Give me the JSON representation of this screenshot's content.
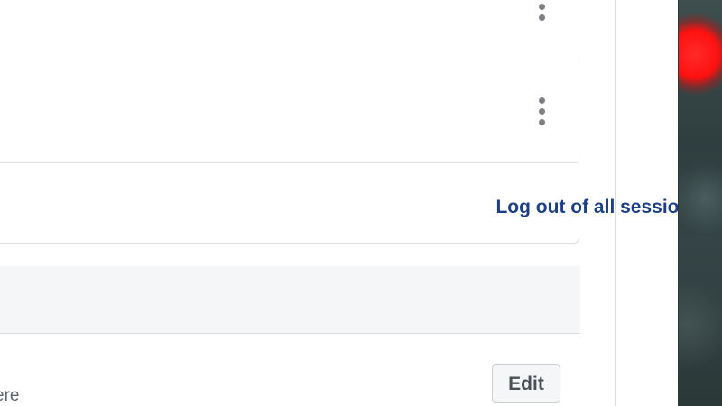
{
  "sessions": {
    "more_icon": "vertical-ellipsis",
    "logout_all_label": "Log out of all sessions"
  },
  "next_section": {
    "setting_partial_text": "ere",
    "edit_label": "Edit"
  },
  "colors": {
    "link": "#1c3f86",
    "border": "#dddfe2",
    "section_bg": "#f5f6f7",
    "photo_accent": "#ff1010"
  }
}
